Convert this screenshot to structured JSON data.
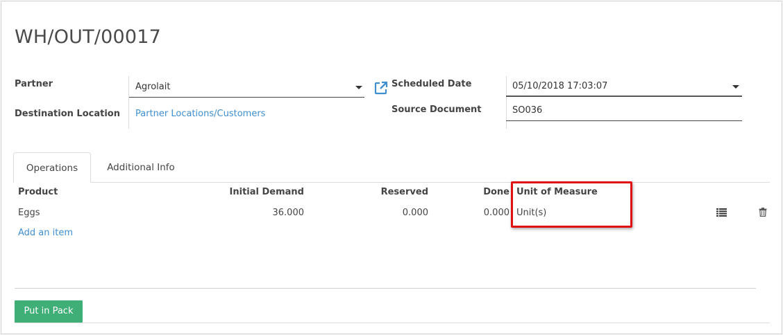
{
  "record": {
    "title": "WH/OUT/00017"
  },
  "form": {
    "partner_label": "Partner",
    "partner_value": "Agrolait",
    "destination_label": "Destination Location",
    "destination_value": "Partner Locations/Customers",
    "scheduled_label": "Scheduled Date",
    "scheduled_value": "05/10/2018 17:03:07",
    "source_label": "Source Document",
    "source_value": "SO036"
  },
  "tabs": [
    {
      "label": "Operations",
      "active": true
    },
    {
      "label": "Additional Info",
      "active": false
    }
  ],
  "table": {
    "headers": {
      "product": "Product",
      "initial_demand": "Initial Demand",
      "reserved": "Reserved",
      "done": "Done",
      "uom": "Unit of Measure"
    },
    "rows": [
      {
        "product": "Eggs",
        "initial_demand": "36.000",
        "reserved": "0.000",
        "done": "0.000",
        "uom": "Unit(s)"
      }
    ],
    "add_item": "Add an item"
  },
  "actions": {
    "put_in_pack": "Put in Pack"
  },
  "icons": {
    "external_link": "external-link-icon",
    "list": "list-icon",
    "trash": "trash-icon"
  },
  "colors": {
    "link": "#3f8fd0",
    "primary_button": "#3fae77",
    "highlight": "#e01010"
  }
}
